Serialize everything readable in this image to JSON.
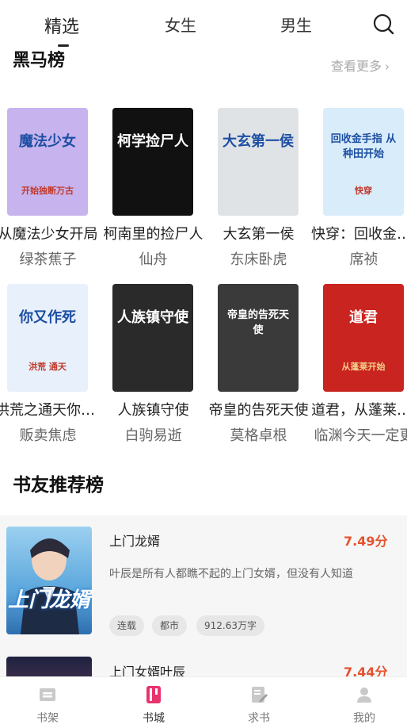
{
  "top_tabs": {
    "items": [
      {
        "label": "精选"
      },
      {
        "label": "女生"
      },
      {
        "label": "男生"
      }
    ],
    "active_index": 0,
    "search_icon": "search-icon"
  },
  "section1": {
    "title": "黑马榜",
    "see_more": "查看更多",
    "see_more_icon": "chevron-right-icon"
  },
  "books": [
    {
      "title": "从魔法少女开局",
      "author": "绿茶蕉子",
      "cover_text": "魔法少女",
      "cover_sub": "开始独断万古",
      "cover_bg": "#c7b3ee"
    },
    {
      "title": "柯南里的捡尸人",
      "author": "仙舟",
      "cover_text": "柯学捡尸人",
      "cover_sub": "",
      "cover_bg": "#111111"
    },
    {
      "title": "大玄第一侯",
      "author": "东床卧虎",
      "cover_text": "大玄第一侯",
      "cover_sub": "",
      "cover_bg": "#dfe3e6"
    },
    {
      "title": "快穿：回收金手指",
      "author": "席祯",
      "cover_text": "回收金手指 从种田开始",
      "cover_sub": "快穿",
      "cover_bg": "#d9ecf9"
    },
    {
      "title": "洪荒之通天你作死",
      "author": "贩卖焦虑",
      "cover_text": "你又作死",
      "cover_sub": "洪荒 通天",
      "cover_bg": "#e8f0fb"
    },
    {
      "title": "人族镇守使",
      "author": "白驹易逝",
      "cover_text": "人族镇守使",
      "cover_sub": "",
      "cover_bg": "#2a2a2a"
    },
    {
      "title": "帝皇的告死天使",
      "author": "莫格卓根",
      "cover_text": "帝皇的告死天使",
      "cover_sub": "",
      "cover_bg": "#3a3a3a"
    },
    {
      "title": "道君，从蓬莱开始",
      "author": "临渊今天一定更",
      "cover_text": "道君",
      "cover_sub": "从蓬莱开始",
      "cover_bg": "#c9241f"
    }
  ],
  "section2": {
    "title": "书友推荐榜",
    "items": [
      {
        "name": "上门龙婿",
        "score": "7.49分",
        "desc": "叶辰是所有人都瞧不起的上门女婿，但没有人知道",
        "tags": [
          "连载",
          "都市",
          "912.63万字"
        ],
        "cover_text": "上门龙婿"
      },
      {
        "name": "上门女婿叶辰",
        "score": "7.44分",
        "desc": "",
        "tags": [],
        "cover_text": ""
      }
    ]
  },
  "bottom_nav": {
    "items": [
      {
        "label": "书架",
        "icon": "bookshelf-icon"
      },
      {
        "label": "书城",
        "icon": "bookstore-icon"
      },
      {
        "label": "求书",
        "icon": "request-book-icon"
      },
      {
        "label": "我的",
        "icon": "profile-icon"
      }
    ],
    "active_index": 1,
    "accent": "#e8336d"
  }
}
